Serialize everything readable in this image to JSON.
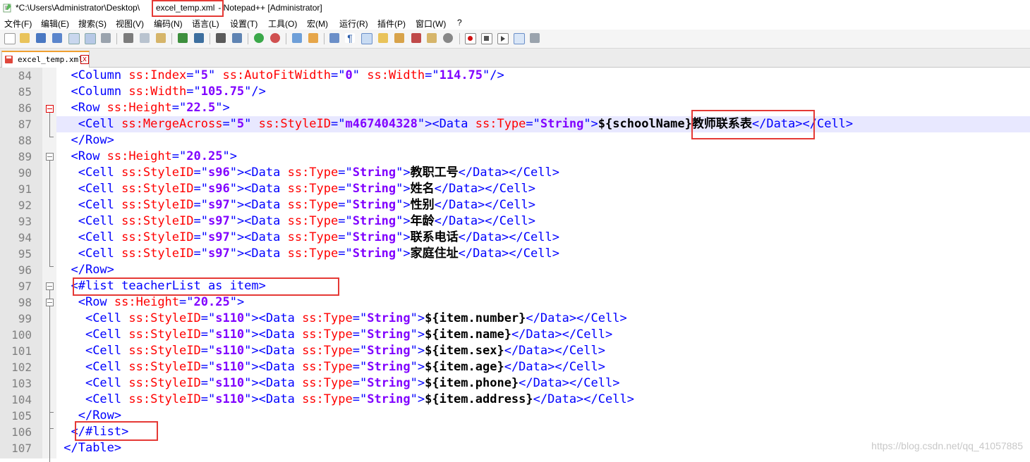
{
  "titlebar": {
    "prefix": "*C:\\Users\\Administrator\\Desktop\\",
    "filename": "excel_temp.xml",
    "suffix": " - Notepad++ [Administrator]"
  },
  "menu": [
    "文件(F)",
    "编辑(E)",
    "搜索(S)",
    "视图(V)",
    "编码(N)",
    "语言(L)",
    "设置(T)",
    "工具(O)",
    "宏(M)",
    "运行(R)",
    "插件(P)",
    "窗口(W)",
    "?"
  ],
  "toolbar_icons": [
    "new-file-icon",
    "open-icon",
    "save-icon",
    "save-all-icon",
    "close-icon",
    "close-all-icon",
    "print-icon",
    "cut-icon",
    "copy-icon",
    "paste-icon",
    "undo-icon",
    "redo-icon",
    "find-icon",
    "replace-icon",
    "zoom-in-icon",
    "zoom-out-icon",
    "sync-v-icon",
    "sync-h-icon",
    "word-wrap-icon",
    "all-chars-icon",
    "indent-guide-icon",
    "lang-udl-icon",
    "doc-map-icon",
    "function-list-icon",
    "folder-workspace-icon",
    "monitor-icon",
    "record-macro-icon",
    "stop-record-icon",
    "play-macro-icon",
    "run-macro-multiple-icon",
    "save-macro-icon"
  ],
  "tab": {
    "label": "excel_temp.xml",
    "close": "x"
  },
  "lines": [
    {
      "n": "84",
      "tokens": [
        [
          "g",
          "  "
        ],
        [
          "t",
          "<Column "
        ],
        [
          "a",
          "ss:Index"
        ],
        [
          "t",
          "=\""
        ],
        [
          "v",
          "5"
        ],
        [
          "t",
          "\" "
        ],
        [
          "a",
          "ss:AutoFitWidth"
        ],
        [
          "t",
          "=\""
        ],
        [
          "v",
          "0"
        ],
        [
          "t",
          "\" "
        ],
        [
          "a",
          "ss:Width"
        ],
        [
          "t",
          "=\""
        ],
        [
          "v",
          "114.75"
        ],
        [
          "t",
          "\"/>"
        ]
      ]
    },
    {
      "n": "85",
      "tokens": [
        [
          "g",
          "  "
        ],
        [
          "t",
          "<Column "
        ],
        [
          "a",
          "ss:Width"
        ],
        [
          "t",
          "=\""
        ],
        [
          "v",
          "105.75"
        ],
        [
          "t",
          "\"/>"
        ]
      ]
    },
    {
      "n": "86",
      "tokens": [
        [
          "g",
          "  "
        ],
        [
          "t",
          "<Row "
        ],
        [
          "a",
          "ss:Height"
        ],
        [
          "t",
          "=\""
        ],
        [
          "v",
          "22.5"
        ],
        [
          "t",
          "\">"
        ]
      ]
    },
    {
      "n": "87",
      "tokens": [
        [
          "g",
          "   "
        ],
        [
          "t",
          "<Cell "
        ],
        [
          "a",
          "ss:MergeAcross"
        ],
        [
          "t",
          "=\""
        ],
        [
          "v",
          "5"
        ],
        [
          "t",
          "\" "
        ],
        [
          "a",
          "ss:StyleID"
        ],
        [
          "t",
          "=\""
        ],
        [
          "v",
          "m467404328"
        ],
        [
          "t",
          "\"><Data "
        ],
        [
          "a",
          "ss:Type"
        ],
        [
          "t",
          "=\""
        ],
        [
          "v",
          "String"
        ],
        [
          "t",
          "\">"
        ],
        [
          "x",
          "${schoolName}"
        ],
        [
          "c",
          "教师联系表"
        ],
        [
          "t",
          "</Data></Cell>"
        ]
      ]
    },
    {
      "n": "88",
      "tokens": [
        [
          "g",
          "  "
        ],
        [
          "t",
          "</Row>"
        ]
      ]
    },
    {
      "n": "89",
      "tokens": [
        [
          "g",
          "  "
        ],
        [
          "t",
          "<Row "
        ],
        [
          "a",
          "ss:Height"
        ],
        [
          "t",
          "=\""
        ],
        [
          "v",
          "20.25"
        ],
        [
          "t",
          "\">"
        ]
      ]
    },
    {
      "n": "90",
      "tokens": [
        [
          "g",
          "   "
        ],
        [
          "t",
          "<Cell "
        ],
        [
          "a",
          "ss:StyleID"
        ],
        [
          "t",
          "=\""
        ],
        [
          "v",
          "s96"
        ],
        [
          "t",
          "\"><Data "
        ],
        [
          "a",
          "ss:Type"
        ],
        [
          "t",
          "=\""
        ],
        [
          "v",
          "String"
        ],
        [
          "t",
          "\">"
        ],
        [
          "c",
          "教职工号"
        ],
        [
          "t",
          "</Data></Cell>"
        ]
      ]
    },
    {
      "n": "91",
      "tokens": [
        [
          "g",
          "   "
        ],
        [
          "t",
          "<Cell "
        ],
        [
          "a",
          "ss:StyleID"
        ],
        [
          "t",
          "=\""
        ],
        [
          "v",
          "s96"
        ],
        [
          "t",
          "\"><Data "
        ],
        [
          "a",
          "ss:Type"
        ],
        [
          "t",
          "=\""
        ],
        [
          "v",
          "String"
        ],
        [
          "t",
          "\">"
        ],
        [
          "c",
          "姓名"
        ],
        [
          "t",
          "</Data></Cell>"
        ]
      ]
    },
    {
      "n": "92",
      "tokens": [
        [
          "g",
          "   "
        ],
        [
          "t",
          "<Cell "
        ],
        [
          "a",
          "ss:StyleID"
        ],
        [
          "t",
          "=\""
        ],
        [
          "v",
          "s97"
        ],
        [
          "t",
          "\"><Data "
        ],
        [
          "a",
          "ss:Type"
        ],
        [
          "t",
          "=\""
        ],
        [
          "v",
          "String"
        ],
        [
          "t",
          "\">"
        ],
        [
          "c",
          "性别"
        ],
        [
          "t",
          "</Data></Cell>"
        ]
      ]
    },
    {
      "n": "93",
      "tokens": [
        [
          "g",
          "   "
        ],
        [
          "t",
          "<Cell "
        ],
        [
          "a",
          "ss:StyleID"
        ],
        [
          "t",
          "=\""
        ],
        [
          "v",
          "s97"
        ],
        [
          "t",
          "\"><Data "
        ],
        [
          "a",
          "ss:Type"
        ],
        [
          "t",
          "=\""
        ],
        [
          "v",
          "String"
        ],
        [
          "t",
          "\">"
        ],
        [
          "c",
          "年龄"
        ],
        [
          "t",
          "</Data></Cell>"
        ]
      ]
    },
    {
      "n": "94",
      "tokens": [
        [
          "g",
          "   "
        ],
        [
          "t",
          "<Cell "
        ],
        [
          "a",
          "ss:StyleID"
        ],
        [
          "t",
          "=\""
        ],
        [
          "v",
          "s97"
        ],
        [
          "t",
          "\"><Data "
        ],
        [
          "a",
          "ss:Type"
        ],
        [
          "t",
          "=\""
        ],
        [
          "v",
          "String"
        ],
        [
          "t",
          "\">"
        ],
        [
          "c",
          "联系电话"
        ],
        [
          "t",
          "</Data></Cell>"
        ]
      ]
    },
    {
      "n": "95",
      "tokens": [
        [
          "g",
          "   "
        ],
        [
          "t",
          "<Cell "
        ],
        [
          "a",
          "ss:StyleID"
        ],
        [
          "t",
          "=\""
        ],
        [
          "v",
          "s97"
        ],
        [
          "t",
          "\"><Data "
        ],
        [
          "a",
          "ss:Type"
        ],
        [
          "t",
          "=\""
        ],
        [
          "v",
          "String"
        ],
        [
          "t",
          "\">"
        ],
        [
          "c",
          "家庭住址"
        ],
        [
          "t",
          "</Data></Cell>"
        ]
      ]
    },
    {
      "n": "96",
      "tokens": [
        [
          "g",
          "  "
        ],
        [
          "t",
          "</Row>"
        ]
      ]
    },
    {
      "n": "97",
      "tokens": [
        [
          "g",
          "  "
        ],
        [
          "t",
          "<#list teacherList as item>"
        ]
      ]
    },
    {
      "n": "98",
      "tokens": [
        [
          "g",
          "   "
        ],
        [
          "t",
          "<Row "
        ],
        [
          "a",
          "ss:Height"
        ],
        [
          "t",
          "=\""
        ],
        [
          "v",
          "20.25"
        ],
        [
          "t",
          "\">"
        ]
      ]
    },
    {
      "n": "99",
      "tokens": [
        [
          "g",
          "    "
        ],
        [
          "t",
          "<Cell "
        ],
        [
          "a",
          "ss:StyleID"
        ],
        [
          "t",
          "=\""
        ],
        [
          "v",
          "s110"
        ],
        [
          "t",
          "\"><Data "
        ],
        [
          "a",
          "ss:Type"
        ],
        [
          "t",
          "=\""
        ],
        [
          "v",
          "String"
        ],
        [
          "t",
          "\">"
        ],
        [
          "x",
          "${item.number}"
        ],
        [
          "t",
          "</Data></Cell>"
        ]
      ]
    },
    {
      "n": "100",
      "tokens": [
        [
          "g",
          "    "
        ],
        [
          "t",
          "<Cell "
        ],
        [
          "a",
          "ss:StyleID"
        ],
        [
          "t",
          "=\""
        ],
        [
          "v",
          "s110"
        ],
        [
          "t",
          "\"><Data "
        ],
        [
          "a",
          "ss:Type"
        ],
        [
          "t",
          "=\""
        ],
        [
          "v",
          "String"
        ],
        [
          "t",
          "\">"
        ],
        [
          "x",
          "${item.name}"
        ],
        [
          "t",
          "</Data></Cell>"
        ]
      ]
    },
    {
      "n": "101",
      "tokens": [
        [
          "g",
          "    "
        ],
        [
          "t",
          "<Cell "
        ],
        [
          "a",
          "ss:StyleID"
        ],
        [
          "t",
          "=\""
        ],
        [
          "v",
          "s110"
        ],
        [
          "t",
          "\"><Data "
        ],
        [
          "a",
          "ss:Type"
        ],
        [
          "t",
          "=\""
        ],
        [
          "v",
          "String"
        ],
        [
          "t",
          "\">"
        ],
        [
          "x",
          "${item.sex}"
        ],
        [
          "t",
          "</Data></Cell>"
        ]
      ]
    },
    {
      "n": "102",
      "tokens": [
        [
          "g",
          "    "
        ],
        [
          "t",
          "<Cell "
        ],
        [
          "a",
          "ss:StyleID"
        ],
        [
          "t",
          "=\""
        ],
        [
          "v",
          "s110"
        ],
        [
          "t",
          "\"><Data "
        ],
        [
          "a",
          "ss:Type"
        ],
        [
          "t",
          "=\""
        ],
        [
          "v",
          "String"
        ],
        [
          "t",
          "\">"
        ],
        [
          "x",
          "${item.age}"
        ],
        [
          "t",
          "</Data></Cell>"
        ]
      ]
    },
    {
      "n": "103",
      "tokens": [
        [
          "g",
          "    "
        ],
        [
          "t",
          "<Cell "
        ],
        [
          "a",
          "ss:StyleID"
        ],
        [
          "t",
          "=\""
        ],
        [
          "v",
          "s110"
        ],
        [
          "t",
          "\"><Data "
        ],
        [
          "a",
          "ss:Type"
        ],
        [
          "t",
          "=\""
        ],
        [
          "v",
          "String"
        ],
        [
          "t",
          "\">"
        ],
        [
          "x",
          "${item.phone}"
        ],
        [
          "t",
          "</Data></Cell>"
        ]
      ]
    },
    {
      "n": "104",
      "tokens": [
        [
          "g",
          "    "
        ],
        [
          "t",
          "<Cell "
        ],
        [
          "a",
          "ss:StyleID"
        ],
        [
          "t",
          "=\""
        ],
        [
          "v",
          "s110"
        ],
        [
          "t",
          "\"><Data "
        ],
        [
          "a",
          "ss:Type"
        ],
        [
          "t",
          "=\""
        ],
        [
          "v",
          "String"
        ],
        [
          "t",
          "\">"
        ],
        [
          "x",
          "${item.address}"
        ],
        [
          "t",
          "</Data></Cell>"
        ]
      ]
    },
    {
      "n": "105",
      "tokens": [
        [
          "g",
          "   "
        ],
        [
          "t",
          "</Row>"
        ]
      ]
    },
    {
      "n": "106",
      "tokens": [
        [
          "g",
          "  "
        ],
        [
          "t",
          "</#list>"
        ]
      ]
    },
    {
      "n": "107",
      "tokens": [
        [
          "g",
          " "
        ],
        [
          "t",
          "</Table>"
        ]
      ]
    }
  ],
  "watermark": "https://blog.csdn.net/qq_41057885",
  "colors": {
    "tag": "#0000ff",
    "attr": "#ff0000",
    "value": "#8000ff",
    "highlight": "#e8e8ff",
    "annotation_box": "#e53935"
  }
}
